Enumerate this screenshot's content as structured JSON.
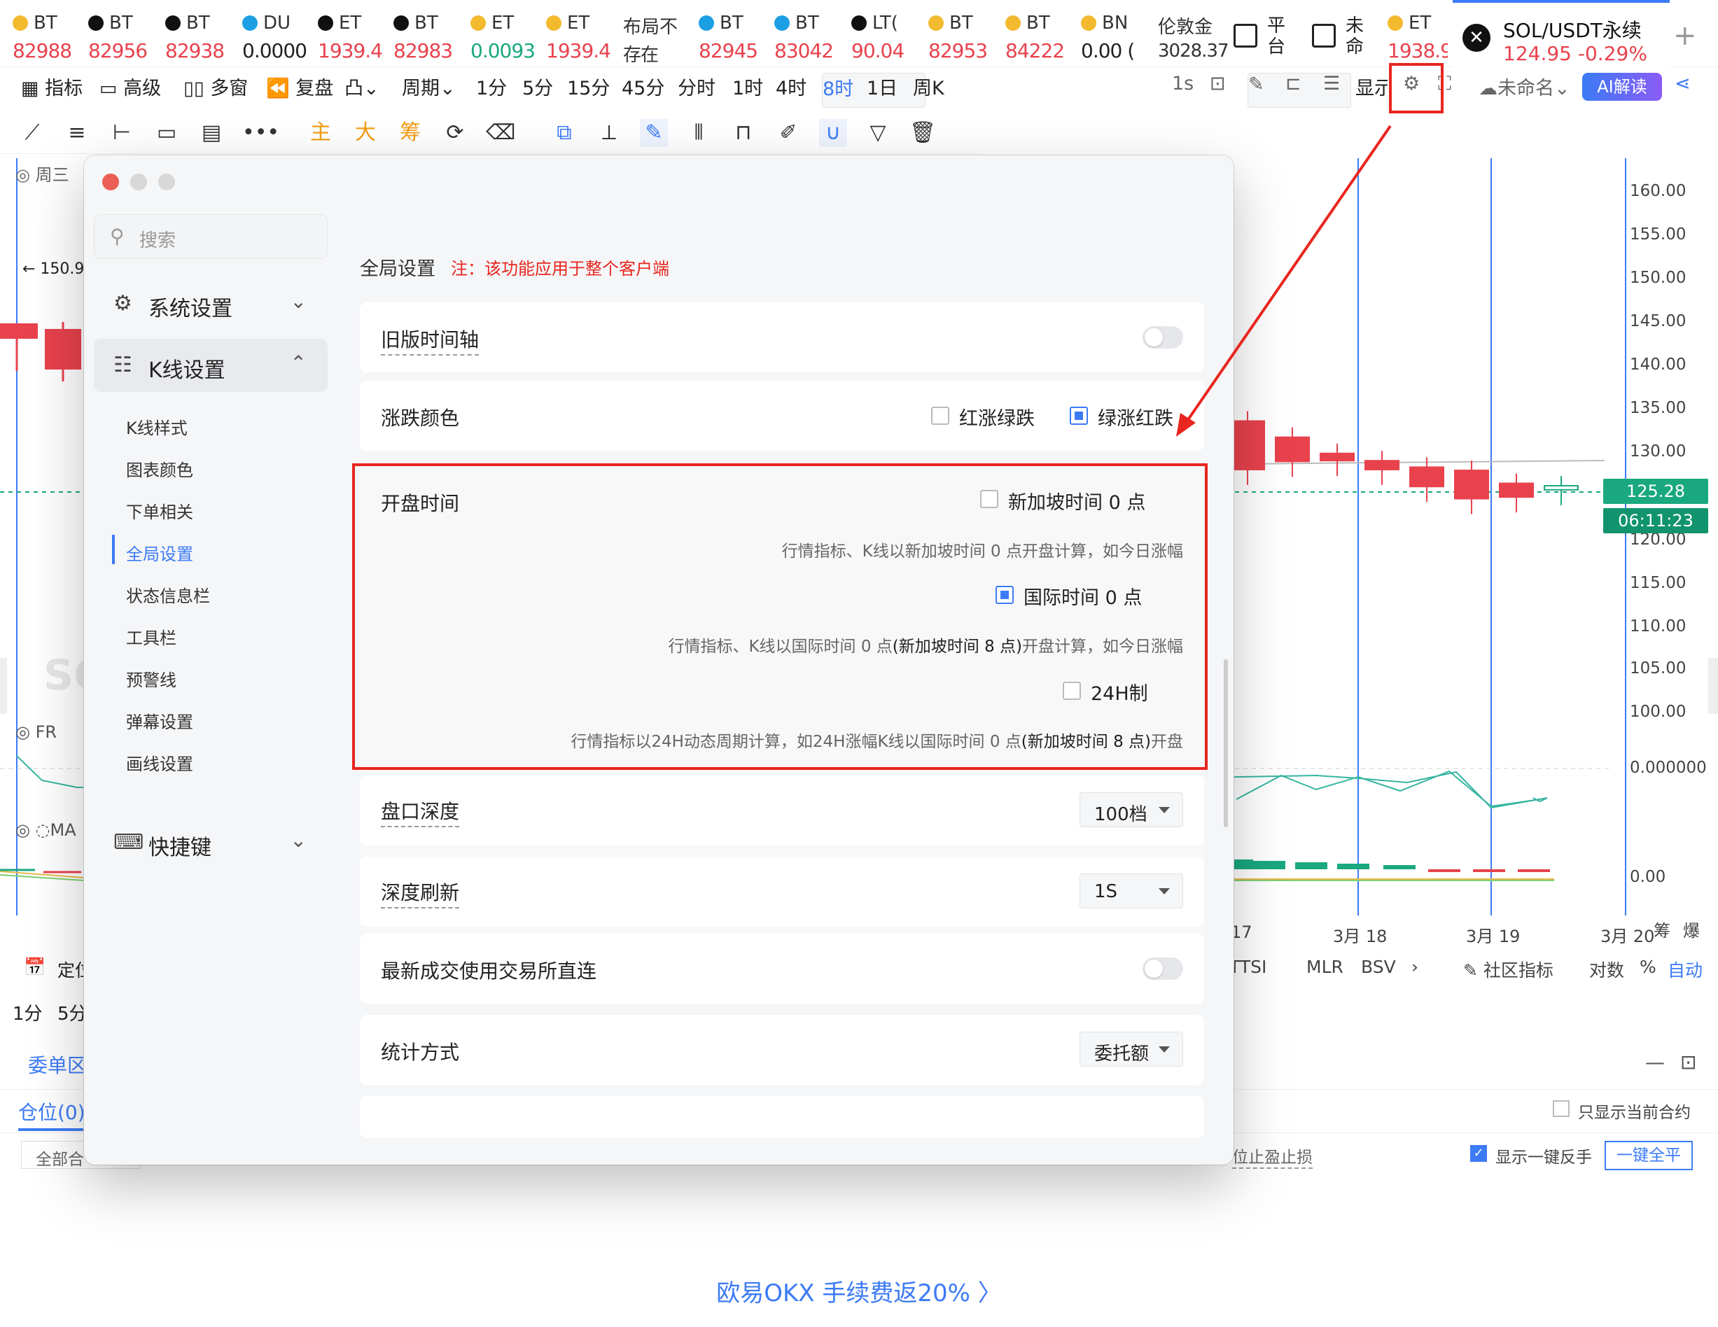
{
  "ticker": [
    {
      "name": "BT",
      "price": "82988",
      "color": "red",
      "icon": "bnb-icon"
    },
    {
      "name": "BT",
      "price": "82956",
      "color": "red",
      "icon": "okx-icon"
    },
    {
      "name": "BT",
      "price": "82938",
      "color": "red",
      "icon": "bitget-icon"
    },
    {
      "name": "DU",
      "price": "0.0000",
      "color": "blk",
      "icon": "exchange-icon"
    },
    {
      "name": "ET",
      "price": "1939.4",
      "color": "red",
      "icon": "okx-icon"
    },
    {
      "name": "BT",
      "price": "82983",
      "color": "red",
      "icon": "okx-icon"
    },
    {
      "name": "ET",
      "price": "0.0093",
      "color": "grn",
      "icon": "bnb-icon"
    },
    {
      "name": "ET",
      "price": "1939.4",
      "color": "red",
      "icon": "bnb-icon"
    },
    {
      "name": "布局不",
      "price": "存在",
      "color": "blk",
      "icon": ""
    },
    {
      "name": "BT",
      "price": "82945",
      "color": "red",
      "icon": "exchange-icon"
    },
    {
      "name": "BT",
      "price": "83042",
      "color": "red",
      "icon": "exchange-icon"
    },
    {
      "name": "LT(",
      "price": "90.04",
      "color": "red",
      "icon": "okx-icon"
    },
    {
      "name": "BT",
      "price": "82953",
      "color": "red",
      "icon": "bnb-icon"
    },
    {
      "name": "BT",
      "price": "84222",
      "color": "red",
      "icon": "bnb-icon"
    },
    {
      "name": "BN",
      "price": "0.00 (",
      "color": "blk",
      "icon": "bnb-icon"
    },
    {
      "name": "伦敦金",
      "price": "3028.37",
      "color": "grn",
      "icon": ""
    }
  ],
  "ticker_extra": {
    "platform": "平台",
    "unnamed": "未命",
    "eth": "ET",
    "eth_price": "1938.9"
  },
  "active_tab": {
    "name": "SOL/USDT永续",
    "price": "124.95  -0.29%"
  },
  "toolbar": {
    "indicators": "指标",
    "advanced": "高级",
    "multi": "多窗",
    "replay": "复盘",
    "period": "周期",
    "periods": [
      "1分",
      "5分",
      "15分",
      "45分",
      "分时",
      "1时",
      "4时",
      "8时",
      "1日",
      "周K"
    ],
    "selected_period": "8时",
    "right_1s": "1s",
    "display": "显示",
    "unnamed": "未命名",
    "ai": "AI解读"
  },
  "draw_tools": {
    "main": "主",
    "big": "大",
    "chip": "筹"
  },
  "chart": {
    "week_label": "周三",
    "high_marker": "← 150.9",
    "wm": "SO",
    "fr_label": "FR",
    "ma_label": "MA",
    "y_ticks": [
      "160.00",
      "155.00",
      "150.00",
      "145.00",
      "140.00",
      "135.00",
      "130.00",
      "125.28",
      "06:11:23",
      "120.00",
      "115.00",
      "110.00",
      "105.00",
      "100.00",
      "0.000000",
      "0.00"
    ],
    "x_ticks": [
      "17",
      "3月 18",
      "3月 19",
      "3月 20"
    ],
    "x_suffix": "筹",
    "x_suffix2": "爆"
  },
  "chart_data": {
    "type": "candlestick",
    "current_price": 125.28,
    "countdown": "06:11:23",
    "ylim": [
      98,
      162
    ],
    "candles": [
      {
        "o": 133.5,
        "c": 127.5
      },
      {
        "o": 131.5,
        "c": 128.5
      },
      {
        "o": 129.5,
        "c": 128.6
      },
      {
        "o": 128.6,
        "c": 127.5
      },
      {
        "o": 127.8,
        "c": 125.4
      },
      {
        "o": 127.4,
        "c": 123.9
      },
      {
        "o": 125.8,
        "c": 124.1
      },
      {
        "o": 125.0,
        "c": 125.5
      }
    ]
  },
  "indicator_bar": {
    "items": [
      "TTSI",
      "MLR",
      "BSV"
    ],
    "community": "社区指标",
    "log": "对数",
    "pct": "%",
    "auto": "自动",
    "left_label": "定位",
    "left_1": "1分",
    "left_5": "5分"
  },
  "bottom": {
    "tab": "委单区",
    "position": "仓位(0)",
    "all_contracts": "全部合",
    "only_current": "只显示当前合约",
    "stop": "位止盈止损",
    "show_reverse": "显示一键反手",
    "close_all": "一键全平"
  },
  "promo": "欧易OKX 手续费返20% 〉",
  "settings": {
    "search_placeholder": "搜索",
    "sections": [
      {
        "label": "系统设置",
        "icon": "gear-icon"
      },
      {
        "label": "K线设置",
        "icon": "kline-settings-icon"
      },
      {
        "label": "快捷键",
        "icon": "keyboard-icon"
      }
    ],
    "kline_sub": [
      "K线样式",
      "图表颜色",
      "下单相关",
      "全局设置",
      "状态信息栏",
      "工具栏",
      "预警线",
      "弹幕设置",
      "画线设置"
    ],
    "current_sub": "全局设置",
    "title": "全局设置",
    "note": "注：该功能应用于整个客户端",
    "old_axis": "旧版时间轴",
    "color_label": "涨跌颜色",
    "color_opt1": "红涨绿跌",
    "color_opt2": "绿涨红跌",
    "open_time": "开盘时间",
    "sg_label": "新加坡时间 0 点",
    "sg_desc": "行情指标、K线以新加坡时间 0 点开盘计算，如今日涨幅",
    "intl_label": "国际时间 0 点",
    "intl_desc_a": "行情指标、K线以国际时间 0 点",
    "intl_desc_b": "(新加坡时间 8 点)",
    "intl_desc_c": "开盘计算，如今日涨幅",
    "h24_label": "24H制",
    "h24_desc_a": "行情指标以24H动态周期计算，如24H涨幅K线以国际时间 0 点",
    "h24_desc_b": "(新加坡时间 8 点)",
    "h24_desc_c": "开盘",
    "depth_label": "盘口深度",
    "depth_value": "100档",
    "refresh_label": "深度刷新",
    "refresh_value": "1S",
    "direct_label": "最新成交使用交易所直连",
    "stats_label": "统计方式",
    "stats_value": "委托额"
  }
}
